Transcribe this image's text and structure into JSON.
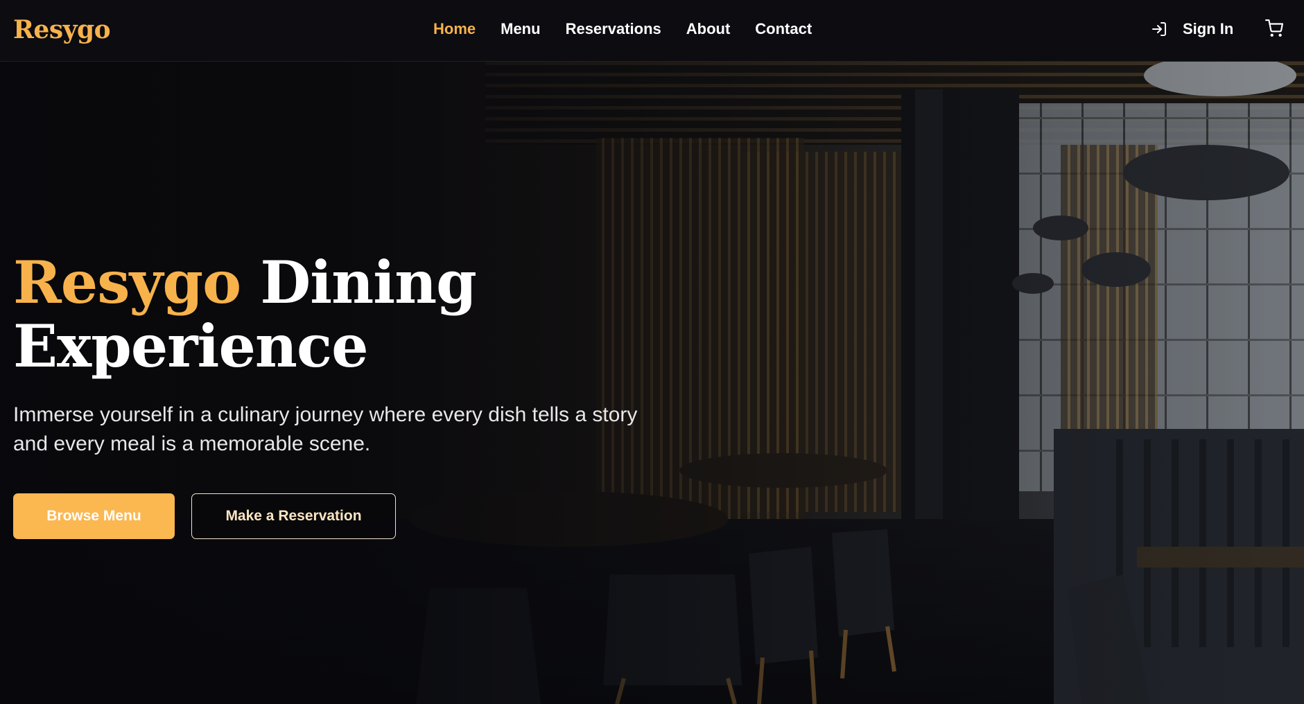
{
  "brand": {
    "name": "Resygo"
  },
  "nav": {
    "items": [
      {
        "label": "Home",
        "active": true
      },
      {
        "label": "Menu",
        "active": false
      },
      {
        "label": "Reservations",
        "active": false
      },
      {
        "label": "About",
        "active": false
      },
      {
        "label": "Contact",
        "active": false
      }
    ]
  },
  "header_actions": {
    "sign_in_label": "Sign In",
    "sign_in_icon": "login-icon",
    "cart_icon": "cart-icon"
  },
  "hero": {
    "title_accent": "Resygo",
    "title_rest": "Dining",
    "title_line2": "Experience",
    "subtitle_line1": "Immerse yourself in a culinary journey where every dish tells a story",
    "subtitle_line2": "and every meal is a memorable scene.",
    "primary_button": "Browse Menu",
    "secondary_button": "Make a Reservation",
    "background_image": "restaurant-interior-photo"
  },
  "colors": {
    "accent": "#f7b24c",
    "button_primary": "#fbb750",
    "header_bg": "#0c0c11",
    "text_light": "#ffffff"
  }
}
